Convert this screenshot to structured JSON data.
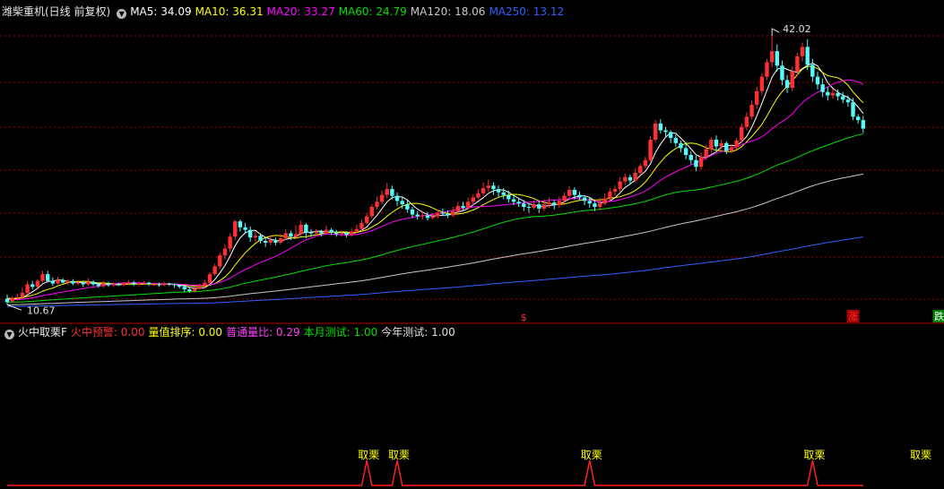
{
  "main_header": {
    "title": "潍柴重机(日线 前复权)",
    "ma_items": [
      {
        "label": "MA5: 34.09",
        "color": "#ffffff"
      },
      {
        "label": "MA10: 36.31",
        "color": "#ffff00"
      },
      {
        "label": "MA20: 33.27",
        "color": "#ff00ff"
      },
      {
        "label": "MA60: 24.79",
        "color": "#00e000"
      },
      {
        "label": "MA120: 18.06",
        "color": "#c8c8c8"
      },
      {
        "label": "MA250: 13.12",
        "color": "#3060ff"
      }
    ]
  },
  "sub_header": {
    "title": "火中取栗F",
    "items": [
      {
        "label": "火中预警: 0.00",
        "color": "#ff3030"
      },
      {
        "label": "量值排序: 0.00",
        "color": "#ffff00"
      },
      {
        "label": "普通量比: 0.29",
        "color": "#ff40ff"
      },
      {
        "label": "本月测试: 1.00",
        "color": "#00e000"
      },
      {
        "label": "今年测试: 1.00",
        "color": "#e0e0e0"
      }
    ]
  },
  "colors": {
    "up": "#ff3030",
    "down": "#54fcfc",
    "grid": "#a00000",
    "signal": "#ff2020",
    "signal_label": "#ffff00"
  },
  "chart_data": [
    {
      "type": "candlestick",
      "title": "潍柴重机(日线 前复权)",
      "ylim": [
        9.5,
        43.5
      ],
      "high_label": "42.02",
      "low_label": "10.67",
      "markers": [
        {
          "index": 102,
          "text": "$",
          "color": "#ff3030"
        },
        {
          "index": 167,
          "text": "涨",
          "color": "#ff3030"
        },
        {
          "index": 184,
          "text": "跌",
          "color": "#ffffff"
        }
      ],
      "candles": [
        [
          10.7,
          10.3,
          11.2,
          10.0
        ],
        [
          10.4,
          10.8,
          11.0,
          10.2
        ],
        [
          10.8,
          10.9,
          11.3,
          10.5
        ],
        [
          10.9,
          11.4,
          12.0,
          10.7
        ],
        [
          11.4,
          12.4,
          12.8,
          11.2
        ],
        [
          12.4,
          12.1,
          12.8,
          11.8
        ],
        [
          12.1,
          12.8,
          13.0,
          12.0
        ],
        [
          12.8,
          13.6,
          14.0,
          12.6
        ],
        [
          13.6,
          12.8,
          14.0,
          12.6
        ],
        [
          12.8,
          12.5,
          13.2,
          12.2
        ],
        [
          12.5,
          12.9,
          13.3,
          12.4
        ],
        [
          12.9,
          12.6,
          13.1,
          12.5
        ],
        [
          12.6,
          12.8,
          13.0,
          12.3
        ],
        [
          12.8,
          12.5,
          13.0,
          12.3
        ],
        [
          12.5,
          12.6,
          12.9,
          12.3
        ],
        [
          12.6,
          12.4,
          12.8,
          12.1
        ],
        [
          12.4,
          12.7,
          13.1,
          12.2
        ],
        [
          12.7,
          12.4,
          12.9,
          12.2
        ],
        [
          12.4,
          12.2,
          12.6,
          12.0
        ],
        [
          12.2,
          12.5,
          12.8,
          12.0
        ],
        [
          12.5,
          12.3,
          12.7,
          12.1
        ],
        [
          12.3,
          12.4,
          12.6,
          12.1
        ],
        [
          12.4,
          12.3,
          12.6,
          12.2
        ],
        [
          12.3,
          12.5,
          12.7,
          12.2
        ],
        [
          12.5,
          12.6,
          12.9,
          12.3
        ],
        [
          12.6,
          12.4,
          12.8,
          12.2
        ],
        [
          12.4,
          12.5,
          12.7,
          12.2
        ],
        [
          12.5,
          12.6,
          12.8,
          12.4
        ],
        [
          12.6,
          12.4,
          12.7,
          12.2
        ],
        [
          12.4,
          12.4,
          12.6,
          12.2
        ],
        [
          12.4,
          12.3,
          12.6,
          12.1
        ],
        [
          12.3,
          12.5,
          12.7,
          12.2
        ],
        [
          12.5,
          12.4,
          12.6,
          12.2
        ],
        [
          12.4,
          12.3,
          12.5,
          12.0
        ],
        [
          12.3,
          12.1,
          12.4,
          11.9
        ],
        [
          12.1,
          11.8,
          12.2,
          11.5
        ],
        [
          11.8,
          11.6,
          12.0,
          11.4
        ],
        [
          11.6,
          11.9,
          12.1,
          11.4
        ],
        [
          11.9,
          12.2,
          12.5,
          11.8
        ],
        [
          12.2,
          12.6,
          12.9,
          12.0
        ],
        [
          12.6,
          13.6,
          13.8,
          12.5
        ],
        [
          13.6,
          14.5,
          14.8,
          13.4
        ],
        [
          14.5,
          15.8,
          16.1,
          14.2
        ],
        [
          15.8,
          16.6,
          17.1,
          15.3
        ],
        [
          16.6,
          18.0,
          18.4,
          16.2
        ],
        [
          18.0,
          19.8,
          20.0,
          17.6
        ],
        [
          19.8,
          19.1,
          20.0,
          18.6
        ],
        [
          19.1,
          18.8,
          19.6,
          18.3
        ],
        [
          18.8,
          17.9,
          19.2,
          17.4
        ],
        [
          17.9,
          18.1,
          18.6,
          17.4
        ],
        [
          18.1,
          17.5,
          18.4,
          17.2
        ],
        [
          17.5,
          17.3,
          17.9,
          16.8
        ],
        [
          17.3,
          17.6,
          18.1,
          17.0
        ],
        [
          17.6,
          17.3,
          17.9,
          17.0
        ],
        [
          17.3,
          17.8,
          18.3,
          17.1
        ],
        [
          17.8,
          18.4,
          18.9,
          17.6
        ],
        [
          18.4,
          18.0,
          18.7,
          17.6
        ],
        [
          18.0,
          18.3,
          19.3,
          17.8
        ],
        [
          18.3,
          19.4,
          19.9,
          18.1
        ],
        [
          19.4,
          18.5,
          19.6,
          17.8
        ],
        [
          18.5,
          18.4,
          18.9,
          18.0
        ],
        [
          18.4,
          18.6,
          18.9,
          18.2
        ],
        [
          18.6,
          18.4,
          18.8,
          18.0
        ],
        [
          18.4,
          18.8,
          19.3,
          18.3
        ],
        [
          18.8,
          18.5,
          19.0,
          18.2
        ],
        [
          18.5,
          18.3,
          18.8,
          18.0
        ],
        [
          18.3,
          18.4,
          18.7,
          18.0
        ],
        [
          18.4,
          18.2,
          18.6,
          17.9
        ],
        [
          18.2,
          18.6,
          19.0,
          18.0
        ],
        [
          18.6,
          18.9,
          19.4,
          18.4
        ],
        [
          18.9,
          19.6,
          20.0,
          18.6
        ],
        [
          19.6,
          20.4,
          20.8,
          19.4
        ],
        [
          20.4,
          21.5,
          21.8,
          20.2
        ],
        [
          21.5,
          22.1,
          22.7,
          21.2
        ],
        [
          22.1,
          22.9,
          23.4,
          21.8
        ],
        [
          22.9,
          23.6,
          24.3,
          22.5
        ],
        [
          23.6,
          22.8,
          24.0,
          22.4
        ],
        [
          22.8,
          22.2,
          23.2,
          21.6
        ],
        [
          22.2,
          21.8,
          22.6,
          21.3
        ],
        [
          21.8,
          21.2,
          22.3,
          20.8
        ],
        [
          21.2,
          20.6,
          21.5,
          20.2
        ],
        [
          20.6,
          20.4,
          21.0,
          20.0
        ],
        [
          20.4,
          20.5,
          20.9,
          20.0
        ],
        [
          20.5,
          20.2,
          20.9,
          19.9
        ],
        [
          20.2,
          20.4,
          20.8,
          20.0
        ],
        [
          20.4,
          20.8,
          21.2,
          20.1
        ],
        [
          20.8,
          20.7,
          21.3,
          20.4
        ],
        [
          20.7,
          20.5,
          21.1,
          20.2
        ],
        [
          20.5,
          21.0,
          21.5,
          20.3
        ],
        [
          21.0,
          21.6,
          22.1,
          20.7
        ],
        [
          21.6,
          21.4,
          22.1,
          21.0
        ],
        [
          21.4,
          22.1,
          22.6,
          21.2
        ],
        [
          22.1,
          22.6,
          23.0,
          21.7
        ],
        [
          22.6,
          23.1,
          23.6,
          22.4
        ],
        [
          23.1,
          23.7,
          24.4,
          22.8
        ],
        [
          23.7,
          24.0,
          24.7,
          23.3
        ],
        [
          24.0,
          23.6,
          24.4,
          22.9
        ],
        [
          23.6,
          23.2,
          24.0,
          22.6
        ],
        [
          23.2,
          22.9,
          23.7,
          22.4
        ],
        [
          22.9,
          22.4,
          23.4,
          22.0
        ],
        [
          22.4,
          22.1,
          22.9,
          21.7
        ],
        [
          22.1,
          21.9,
          22.5,
          21.5
        ],
        [
          21.9,
          21.5,
          22.3,
          21.0
        ],
        [
          21.5,
          21.4,
          21.9,
          20.8
        ],
        [
          21.4,
          21.8,
          22.3,
          21.2
        ],
        [
          21.8,
          21.3,
          22.2,
          20.8
        ],
        [
          21.3,
          21.8,
          22.4,
          21.0
        ],
        [
          21.8,
          22.0,
          22.6,
          21.4
        ],
        [
          22.0,
          21.7,
          22.3,
          21.2
        ],
        [
          21.7,
          22.2,
          22.7,
          21.4
        ],
        [
          22.2,
          22.8,
          23.2,
          21.9
        ],
        [
          22.8,
          23.5,
          23.9,
          22.5
        ],
        [
          23.5,
          22.9,
          23.8,
          22.4
        ],
        [
          22.9,
          22.6,
          23.3,
          22.2
        ],
        [
          22.6,
          22.2,
          22.9,
          21.7
        ],
        [
          22.2,
          21.9,
          22.6,
          21.4
        ],
        [
          21.9,
          21.5,
          22.3,
          21.0
        ],
        [
          21.5,
          21.9,
          22.6,
          21.1
        ],
        [
          21.9,
          22.5,
          23.1,
          21.7
        ],
        [
          22.5,
          23.3,
          23.7,
          22.2
        ],
        [
          23.3,
          23.6,
          24.0,
          22.8
        ],
        [
          23.6,
          24.5,
          25.0,
          23.2
        ],
        [
          24.5,
          25.0,
          25.4,
          24.1
        ],
        [
          25.0,
          24.6,
          25.3,
          24.1
        ],
        [
          24.6,
          25.5,
          26.0,
          24.4
        ],
        [
          25.5,
          26.3,
          26.6,
          25.2
        ],
        [
          26.3,
          27.0,
          27.4,
          26.0
        ],
        [
          27.0,
          29.4,
          29.8,
          26.8
        ],
        [
          29.4,
          31.3,
          31.7,
          29.1
        ],
        [
          31.3,
          30.5,
          31.8,
          30.1
        ],
        [
          30.5,
          30.3,
          30.9,
          29.7
        ],
        [
          30.3,
          29.6,
          30.5,
          29.0
        ],
        [
          29.6,
          29.0,
          30.0,
          28.6
        ],
        [
          29.0,
          28.4,
          29.3,
          27.9
        ],
        [
          28.4,
          27.6,
          28.9,
          27.1
        ],
        [
          27.6,
          27.0,
          28.0,
          26.5
        ],
        [
          27.0,
          26.2,
          27.5,
          25.7
        ],
        [
          26.2,
          27.4,
          27.9,
          25.9
        ],
        [
          27.4,
          28.3,
          28.8,
          27.0
        ],
        [
          28.3,
          29.4,
          29.7,
          27.9
        ],
        [
          29.4,
          28.6,
          29.9,
          28.1
        ],
        [
          28.6,
          29.0,
          29.4,
          28.2
        ],
        [
          29.0,
          28.1,
          29.2,
          27.7
        ],
        [
          28.1,
          28.5,
          28.9,
          27.8
        ],
        [
          28.5,
          29.3,
          29.6,
          28.2
        ],
        [
          29.3,
          30.9,
          31.3,
          29.0
        ],
        [
          30.9,
          32.1,
          32.6,
          30.5
        ],
        [
          32.1,
          33.5,
          34.0,
          31.8
        ],
        [
          33.5,
          35.1,
          35.6,
          33.0
        ],
        [
          35.1,
          36.8,
          37.2,
          34.7
        ],
        [
          36.8,
          38.5,
          38.9,
          36.4
        ],
        [
          38.5,
          39.8,
          41.6,
          37.9
        ],
        [
          39.8,
          38.1,
          40.6,
          37.4
        ],
        [
          38.1,
          36.4,
          38.7,
          35.8
        ],
        [
          36.4,
          35.5,
          37.0,
          34.9
        ],
        [
          35.5,
          37.4,
          38.0,
          35.1
        ],
        [
          37.4,
          39.2,
          39.6,
          36.9
        ],
        [
          39.2,
          40.3,
          40.8,
          38.6
        ],
        [
          40.3,
          38.2,
          41.2,
          37.6
        ],
        [
          38.2,
          36.8,
          38.9,
          36.2
        ],
        [
          36.8,
          35.9,
          37.4,
          35.3
        ],
        [
          35.9,
          35.0,
          36.6,
          34.4
        ],
        [
          35.0,
          34.6,
          35.6,
          34.0
        ],
        [
          34.6,
          34.9,
          35.4,
          34.2
        ],
        [
          34.9,
          34.5,
          35.3,
          34.0
        ],
        [
          34.5,
          34.1,
          35.0,
          33.7
        ],
        [
          34.1,
          33.8,
          34.6,
          33.3
        ],
        [
          33.8,
          32.1,
          34.3,
          31.7
        ],
        [
          32.1,
          31.7,
          32.4,
          31.3
        ],
        [
          31.7,
          30.7,
          32.2,
          30.2
        ]
      ],
      "series": [
        {
          "name": "MA5",
          "color": "#ffffff"
        },
        {
          "name": "MA10",
          "color": "#ffff00"
        },
        {
          "name": "MA20",
          "color": "#ff00ff"
        },
        {
          "name": "MA60",
          "color": "#00e000"
        },
        {
          "name": "MA120",
          "color": "#c8c8c8"
        },
        {
          "name": "MA250",
          "color": "#3060ff"
        }
      ],
      "ma_last_values": {
        "MA5": 34.09,
        "MA10": 36.31,
        "MA20": 33.27,
        "MA60": 24.79,
        "MA120": 18.06,
        "MA250": 13.12
      }
    },
    {
      "type": "line",
      "title": "火中取栗F",
      "ylim": [
        0,
        1
      ],
      "signal_label": "取栗",
      "signal_indices": [
        71,
        77,
        115,
        159,
        180,
        189
      ]
    }
  ]
}
